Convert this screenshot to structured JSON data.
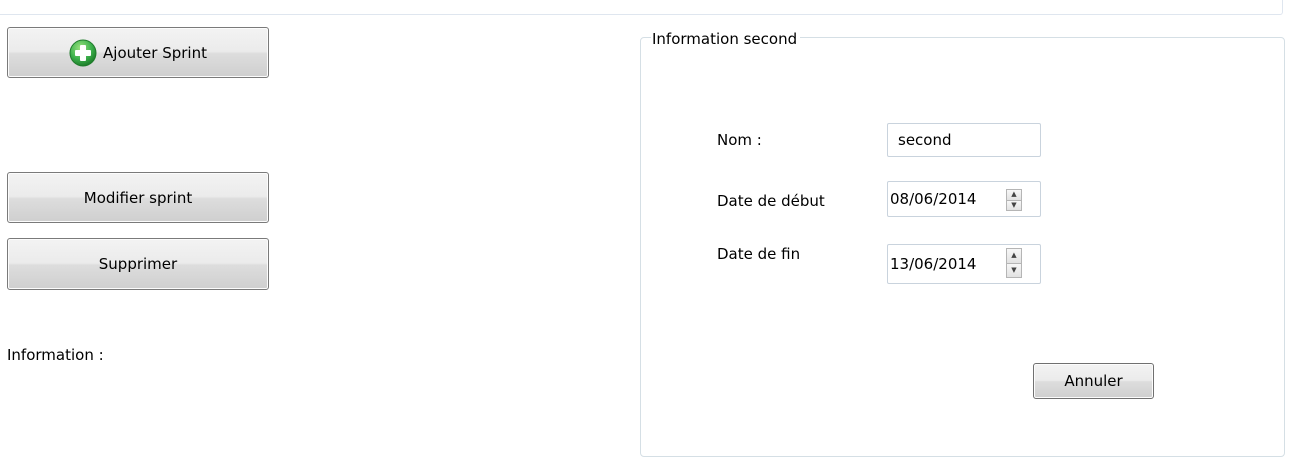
{
  "actions": {
    "add_label": "Ajouter Sprint",
    "modify_label": "Modifier sprint",
    "delete_label": "Supprimer"
  },
  "info_label": "Information :",
  "panel": {
    "title": "Information second",
    "name_label": "Nom :",
    "name_value": "second",
    "start_label": "Date de début",
    "start_value": "08/06/2014",
    "end_label": "Date de fin",
    "end_value": "13/06/2014",
    "cancel_label": "Annuler"
  },
  "icons": {
    "add": "plus-circle-icon",
    "spin_up": "arrow-up-icon",
    "spin_down": "arrow-down-icon"
  },
  "colors": {
    "add_icon": "#3fb34f",
    "panel_border": "#d5dfe5"
  }
}
